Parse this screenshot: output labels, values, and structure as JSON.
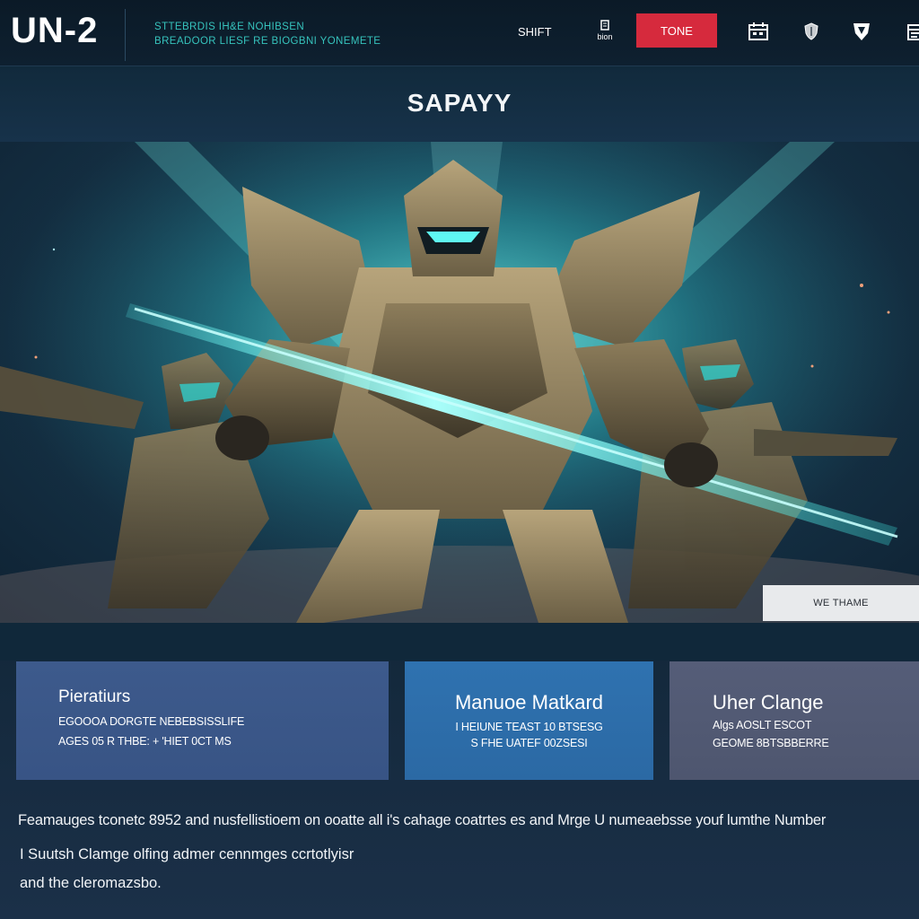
{
  "header": {
    "logo": "UN-2",
    "tagline_line1": "STTEBRDIS IH&E NOHIBSEN",
    "tagline_line2": "BREADOOR LIESF RE BIOGBNI YONEMETE",
    "nav_shift": "SHIFT",
    "nav_small_label": "bion",
    "tone_button": "TONE",
    "icons": [
      "calendar-icon",
      "shield-icon",
      "badge-icon",
      "folder-icon"
    ]
  },
  "page_title": "SAPAYY",
  "hero": {
    "tag": "WE THAME"
  },
  "cards": [
    {
      "title": "Pieratiurs",
      "line1": "EGOOOA DORGTE NEBEBSISSLIFE",
      "line2": "AGES 05 R THBE: + 'HIET 0CT MS"
    },
    {
      "title": "Manuoe Matkard",
      "line1": "I  HEIUNE TEAST 10 BTSESG",
      "line2": "S FHE UATEF 00ZSESI"
    },
    {
      "title": "Uher Clange",
      "line1": "Algs AOSLT ESCOT",
      "line2": "GEOME 8BTSBBERRE"
    }
  ],
  "description": {
    "line1": "Feamauges tconetc 8952 and nusfellistioem on ooatte all i's cahage  coatrtes es and Mrge U numeaebsse youf lumthe Number",
    "line2": "I Suutsh  Clamge olfing admer cennmges ccrtotlyisr",
    "line3": "and the cleromazsbo."
  },
  "colors": {
    "tone_button": "#d62a3d",
    "tagline": "#36c3bd",
    "card1": "#3d5a8c",
    "card2": "#2f72b0",
    "card3": "#555d78"
  }
}
